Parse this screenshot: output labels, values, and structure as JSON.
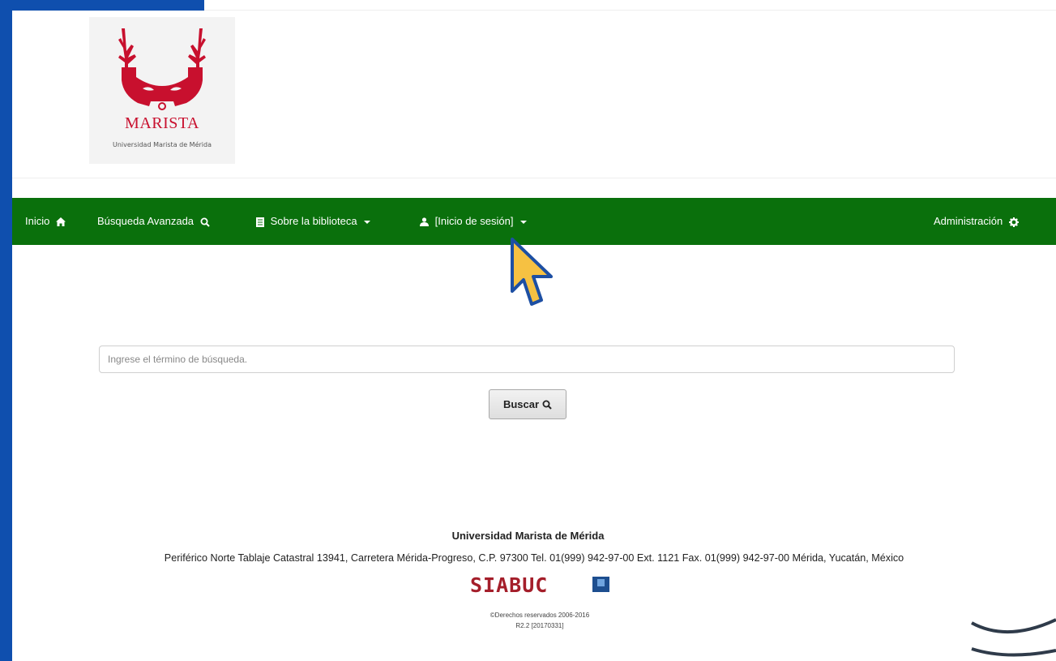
{
  "brand": {
    "logo_text": "MARISTA",
    "logo_subtitle": "Universidad Marista de Mérida",
    "logo_color": "#c8102e"
  },
  "colors": {
    "frame": "#0f4fae",
    "navbar": "#0a700c"
  },
  "navbar": {
    "items": [
      {
        "label": "Inicio",
        "icon": "home-icon"
      },
      {
        "label": "Búsqueda Avanzada",
        "icon": "search-icon"
      },
      {
        "label": "Sobre la biblioteca",
        "icon": "book-icon"
      },
      {
        "label": "[Inicio de sesión]",
        "icon": "user-icon"
      }
    ],
    "admin": {
      "label": "Administración",
      "icon": "gear-icon"
    }
  },
  "search": {
    "placeholder": "Ingrese el término de búsqueda.",
    "button_label": "Buscar"
  },
  "footer": {
    "title": "Universidad Marista de Mérida",
    "address": "Periférico Norte Tablaje Catastral 13941, Carretera Mérida-Progreso, C.P. 97300 Tel. 01(999) 942-97-00 Ext. 1121 Fax. 01(999) 942-97-00 Mérida, Yucatán, México",
    "system_logo": "SIABUC",
    "copyright": "©Derechos reservados 2006-2016",
    "version": "R2.2 [20170331]"
  }
}
